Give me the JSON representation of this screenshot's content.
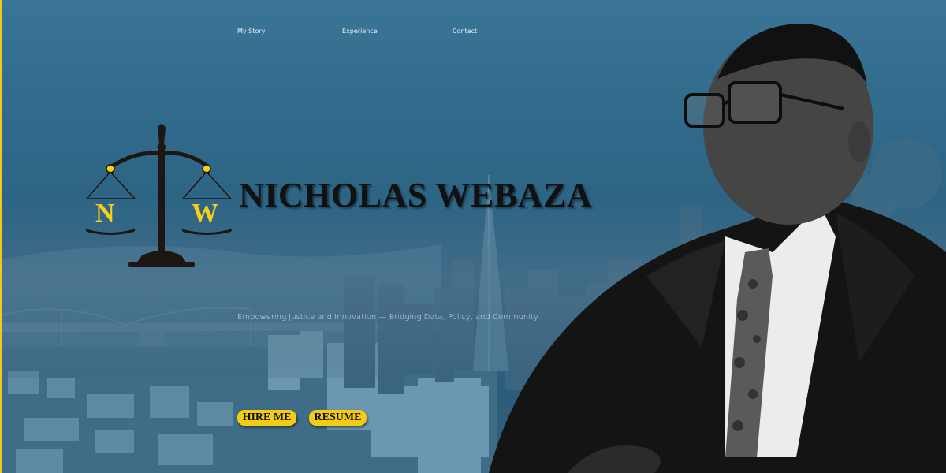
{
  "nav": {
    "items": [
      {
        "label": "My Story"
      },
      {
        "label": "Experience"
      },
      {
        "label": "Contact"
      }
    ]
  },
  "logo": {
    "letter_left": "N",
    "letter_right": "W"
  },
  "hero": {
    "name": "NICHOLAS WEBAZA",
    "tagline": "Empowering Justice and Innovation — Bridging Data, Policy, and Community"
  },
  "buttons": {
    "hire_label": "HIRE ME",
    "resume_label": "RESUME"
  },
  "colors": {
    "accent": "#f5cc14",
    "background": "#2f6584",
    "name_text": "#111111"
  }
}
